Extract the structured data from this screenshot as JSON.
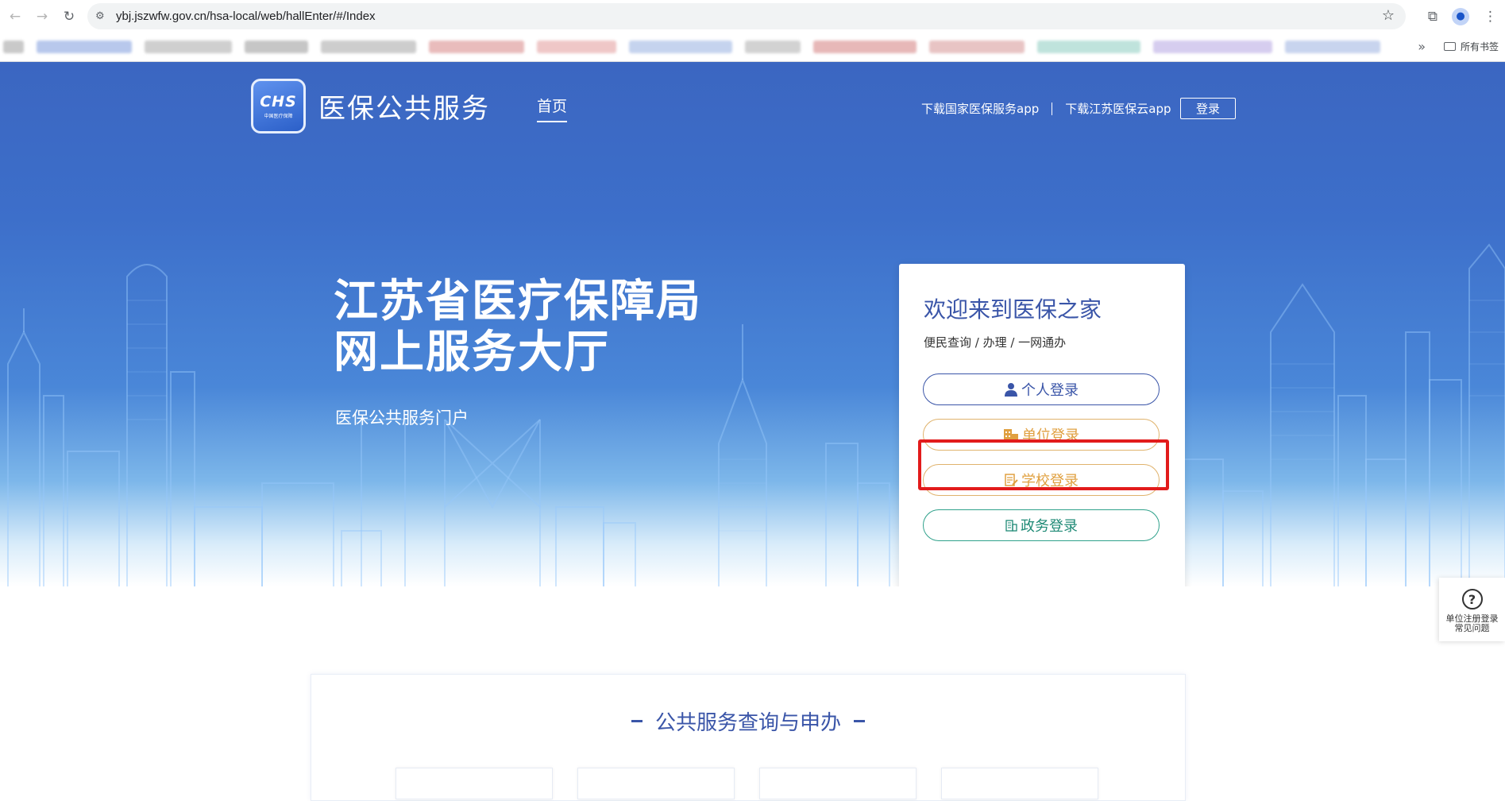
{
  "browser": {
    "url": "ybj.jszwfw.gov.cn/hsa-local/web/hallEnter/#/Index",
    "bookmarks_folder": "所有书签"
  },
  "header": {
    "brand": "医保公共服务",
    "logo_text": "CHS",
    "logo_sub": "中国医疗保障",
    "nav_home": "首页",
    "download_national": "下载国家医保服务app",
    "download_jiangsu": "下载江苏医保云app",
    "login": "登录"
  },
  "hero": {
    "title_line1": "江苏省医疗保障局",
    "title_line2": "网上服务大厅",
    "subtitle": "医保公共服务门户"
  },
  "login_card": {
    "title": "欢迎来到医保之家",
    "subtitle": "便民查询 / 办理 / 一网通办",
    "personal_login": "个人登录",
    "unit_login": "单位登录",
    "school_login": "学校登录",
    "gov_login": "政务登录"
  },
  "help_widget": {
    "line1": "单位注册登录",
    "line2": "常见问题"
  },
  "service": {
    "title": "公共服务查询与申办"
  },
  "colors": {
    "primary": "#3a55a8",
    "unit_accent": "#e0a040",
    "gov_accent": "#1f8a76",
    "highlight": "#e21b1b"
  }
}
